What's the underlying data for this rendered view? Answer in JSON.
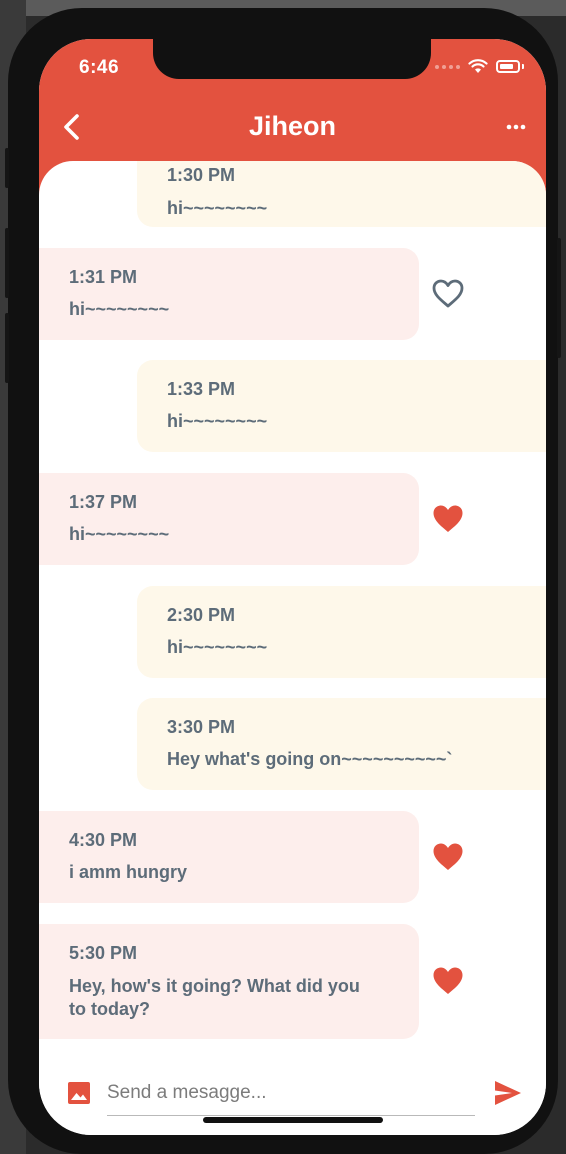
{
  "status_bar": {
    "time": "6:46"
  },
  "header": {
    "title": "Jiheon",
    "back_icon": "chevron-left-icon",
    "menu_icon": "ellipsis-icon",
    "background_color": "#e3523f"
  },
  "messages": [
    {
      "direction": "sent",
      "time": "1:30 PM",
      "text": "hi~~~~~~~~",
      "liked": null
    },
    {
      "direction": "received",
      "time": "1:31 PM",
      "text": "hi~~~~~~~~",
      "liked": false
    },
    {
      "direction": "sent",
      "time": "1:33 PM",
      "text": "hi~~~~~~~~",
      "liked": null
    },
    {
      "direction": "received",
      "time": "1:37 PM",
      "text": "hi~~~~~~~~",
      "liked": true
    },
    {
      "direction": "sent",
      "time": "2:30 PM",
      "text": "hi~~~~~~~~",
      "liked": null
    },
    {
      "direction": "sent",
      "time": "3:30 PM",
      "text": "Hey what's going on~~~~~~~~~~`",
      "liked": null
    },
    {
      "direction": "received",
      "time": "4:30 PM",
      "text": "i amm hungry",
      "liked": true
    },
    {
      "direction": "received",
      "time": "5:30 PM",
      "text": "Hey, how's it going? What did you to today?",
      "liked": true
    }
  ],
  "composer": {
    "placeholder": "Send a mesagge...",
    "value": "",
    "image_icon": "image-icon",
    "send_icon": "send-icon"
  },
  "colors": {
    "accent": "#e3523f",
    "received_bubble": "#fdeeec",
    "sent_bubble": "#fef8ea",
    "message_text": "#5d6c79",
    "heart_outline": "#5d6c79"
  }
}
